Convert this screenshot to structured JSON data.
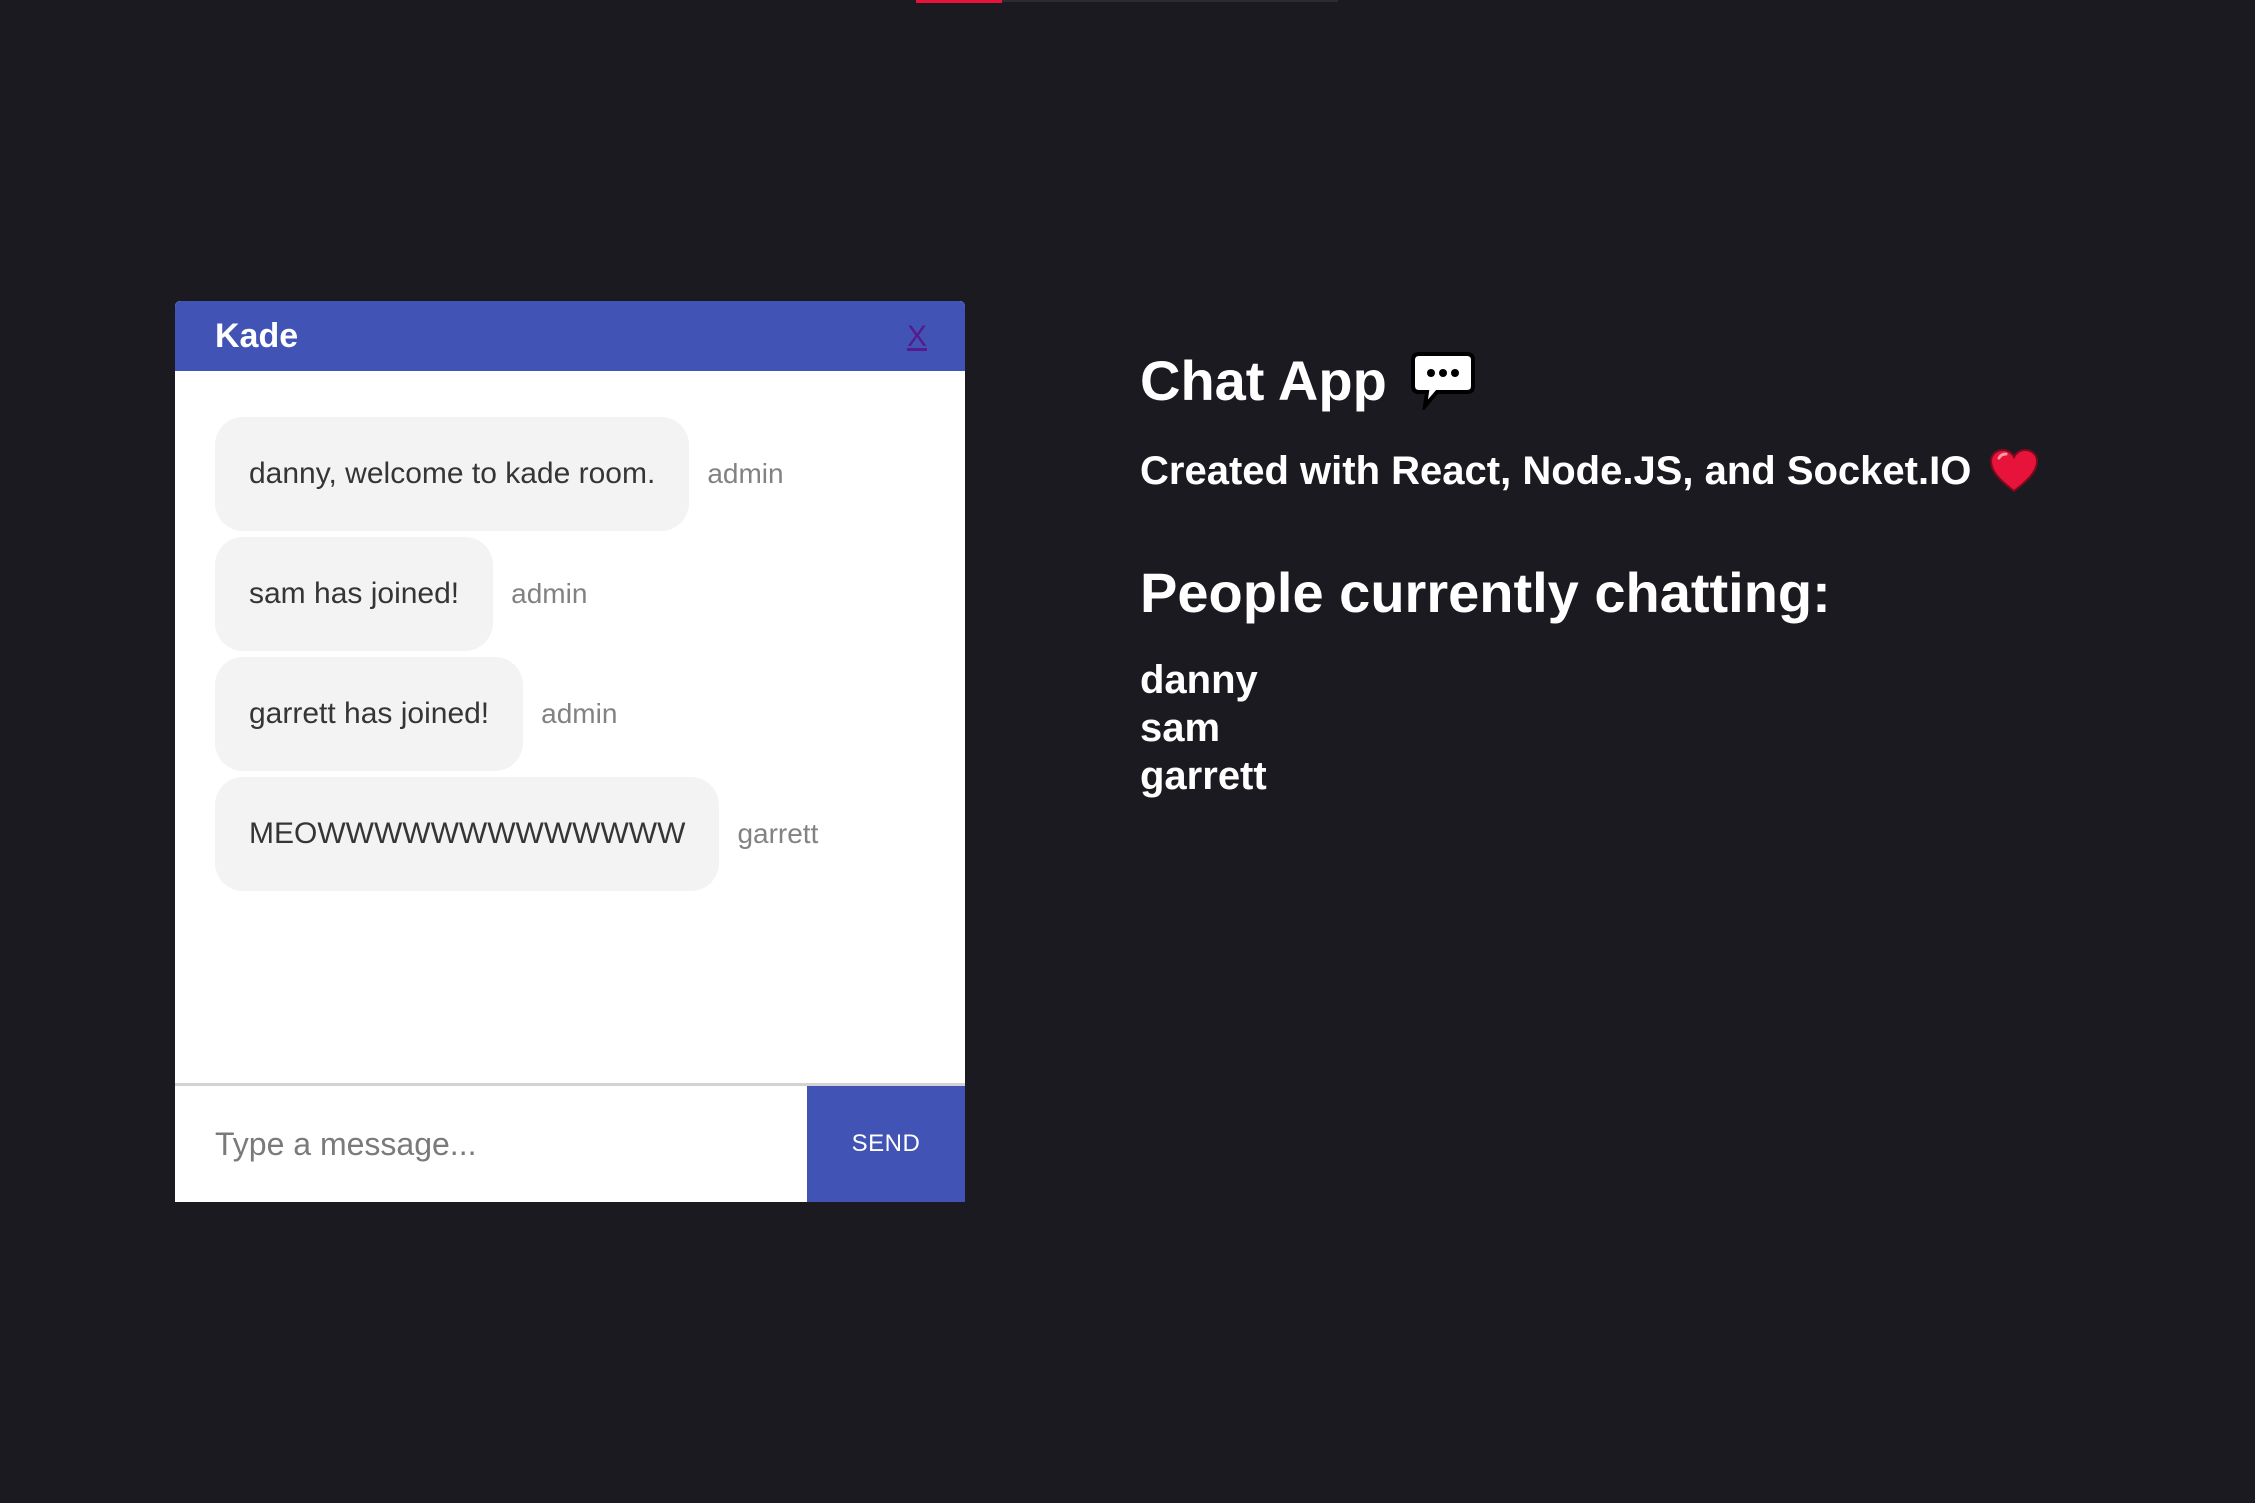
{
  "chat": {
    "room_name": "Kade",
    "close_label": "X",
    "messages": [
      {
        "text": "danny, welcome to kade room.",
        "sender": "admin"
      },
      {
        "text": "sam has joined!",
        "sender": "admin"
      },
      {
        "text": "garrett has joined!",
        "sender": "admin"
      },
      {
        "text": "MEOWWWWWWWWWWWWW",
        "sender": "garrett"
      }
    ],
    "input_placeholder": "Type a message...",
    "send_label": "SEND"
  },
  "info": {
    "title": "Chat App",
    "subtitle": "Created with React, Node.JS, and Socket.IO",
    "people_heading": "People currently chatting:",
    "people": [
      "danny",
      "sam",
      "garrett"
    ]
  },
  "icons": {
    "title_icon": "speech-bubble-icon",
    "subtitle_icon": "heart-icon"
  },
  "colors": {
    "background": "#1b1a20",
    "accent": "#4153b5",
    "bubble": "#f3f3f3",
    "heart": "#e8133a"
  }
}
